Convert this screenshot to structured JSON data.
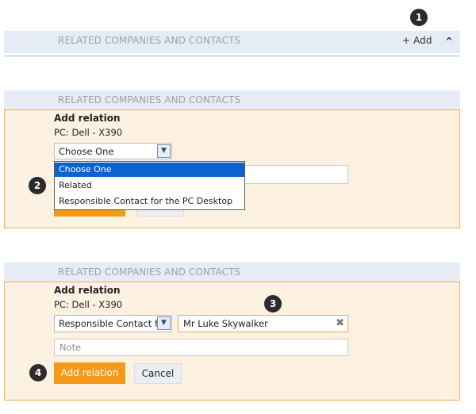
{
  "badges": [
    "1",
    "2",
    "3",
    "4"
  ],
  "header_top": {
    "title": "RELATED COMPANIES AND CONTACTS",
    "add_label": "+ Add",
    "collapse_icon": "^"
  },
  "panel1": {
    "header": "RELATED COMPANIES AND CONTACTS",
    "title": "Add relation",
    "subtitle": "PC: Dell - X390",
    "select_value": "Choose One",
    "options": [
      "Choose One",
      "Related",
      "Responsible Contact for the PC Desktop"
    ]
  },
  "panel2": {
    "header": "RELATED COMPANIES AND CONTACTS",
    "title": "Add relation",
    "subtitle": "PC: Dell - X390",
    "select_value": "Responsible Contact for the PC Desktop",
    "contact_value": "Mr Luke Skywalker",
    "clear_icon": "✖",
    "note_placeholder": "Note",
    "add_button": "Add relation",
    "cancel_button": "Cancel"
  },
  "colors": {
    "accent": "#f39a18",
    "header_bg": "#e6ecf5",
    "panel_bg": "#fdf1e1",
    "select_highlight": "#0a63cf"
  }
}
